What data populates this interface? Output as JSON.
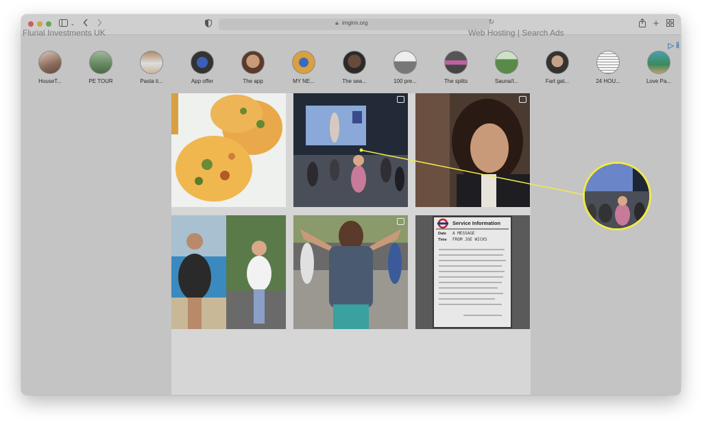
{
  "browser": {
    "url": "imginn.org",
    "colors": {
      "close": "#c8635c",
      "minimize": "#c9a94c",
      "zoom": "#68a45b"
    }
  },
  "page": {
    "behind_left_text": "Flurial Investments UK",
    "behind_right_text": "Web Hosting | Search Ads",
    "ad_icon": "ad-choices-icon"
  },
  "highlights": [
    {
      "label": "HouseT..."
    },
    {
      "label": "PE TOUR"
    },
    {
      "label": "Pasta ti..."
    },
    {
      "label": "App offer"
    },
    {
      "label": "The app"
    },
    {
      "label": "MY NE..."
    },
    {
      "label": "The sea..."
    },
    {
      "label": "100 pre..."
    },
    {
      "label": "The splits"
    },
    {
      "label": "Sauna/I..."
    },
    {
      "label": "Fart gat..."
    },
    {
      "label": "24 HOU..."
    },
    {
      "label": "Love Pa..."
    }
  ],
  "posts": [
    {
      "alt": "egg-muffins-photo",
      "type": "reel"
    },
    {
      "alt": "live-workout-stage-photo",
      "type": "reel"
    },
    {
      "alt": "man-portrait-photo",
      "type": "reel"
    },
    {
      "alt": "before-after-running-photo",
      "type": "post"
    },
    {
      "alt": "man-arms-raised-crowd-photo",
      "type": "reel"
    },
    {
      "alt": "service-information-board-photo",
      "type": "post"
    }
  ],
  "service_board": {
    "header": "Service Information",
    "date_label": "Date",
    "time_label": "Time",
    "date_value": "A MESSAGE",
    "time_value": "FROM JOE WICKS"
  },
  "annotation": {
    "color": "#f0eb4a"
  }
}
